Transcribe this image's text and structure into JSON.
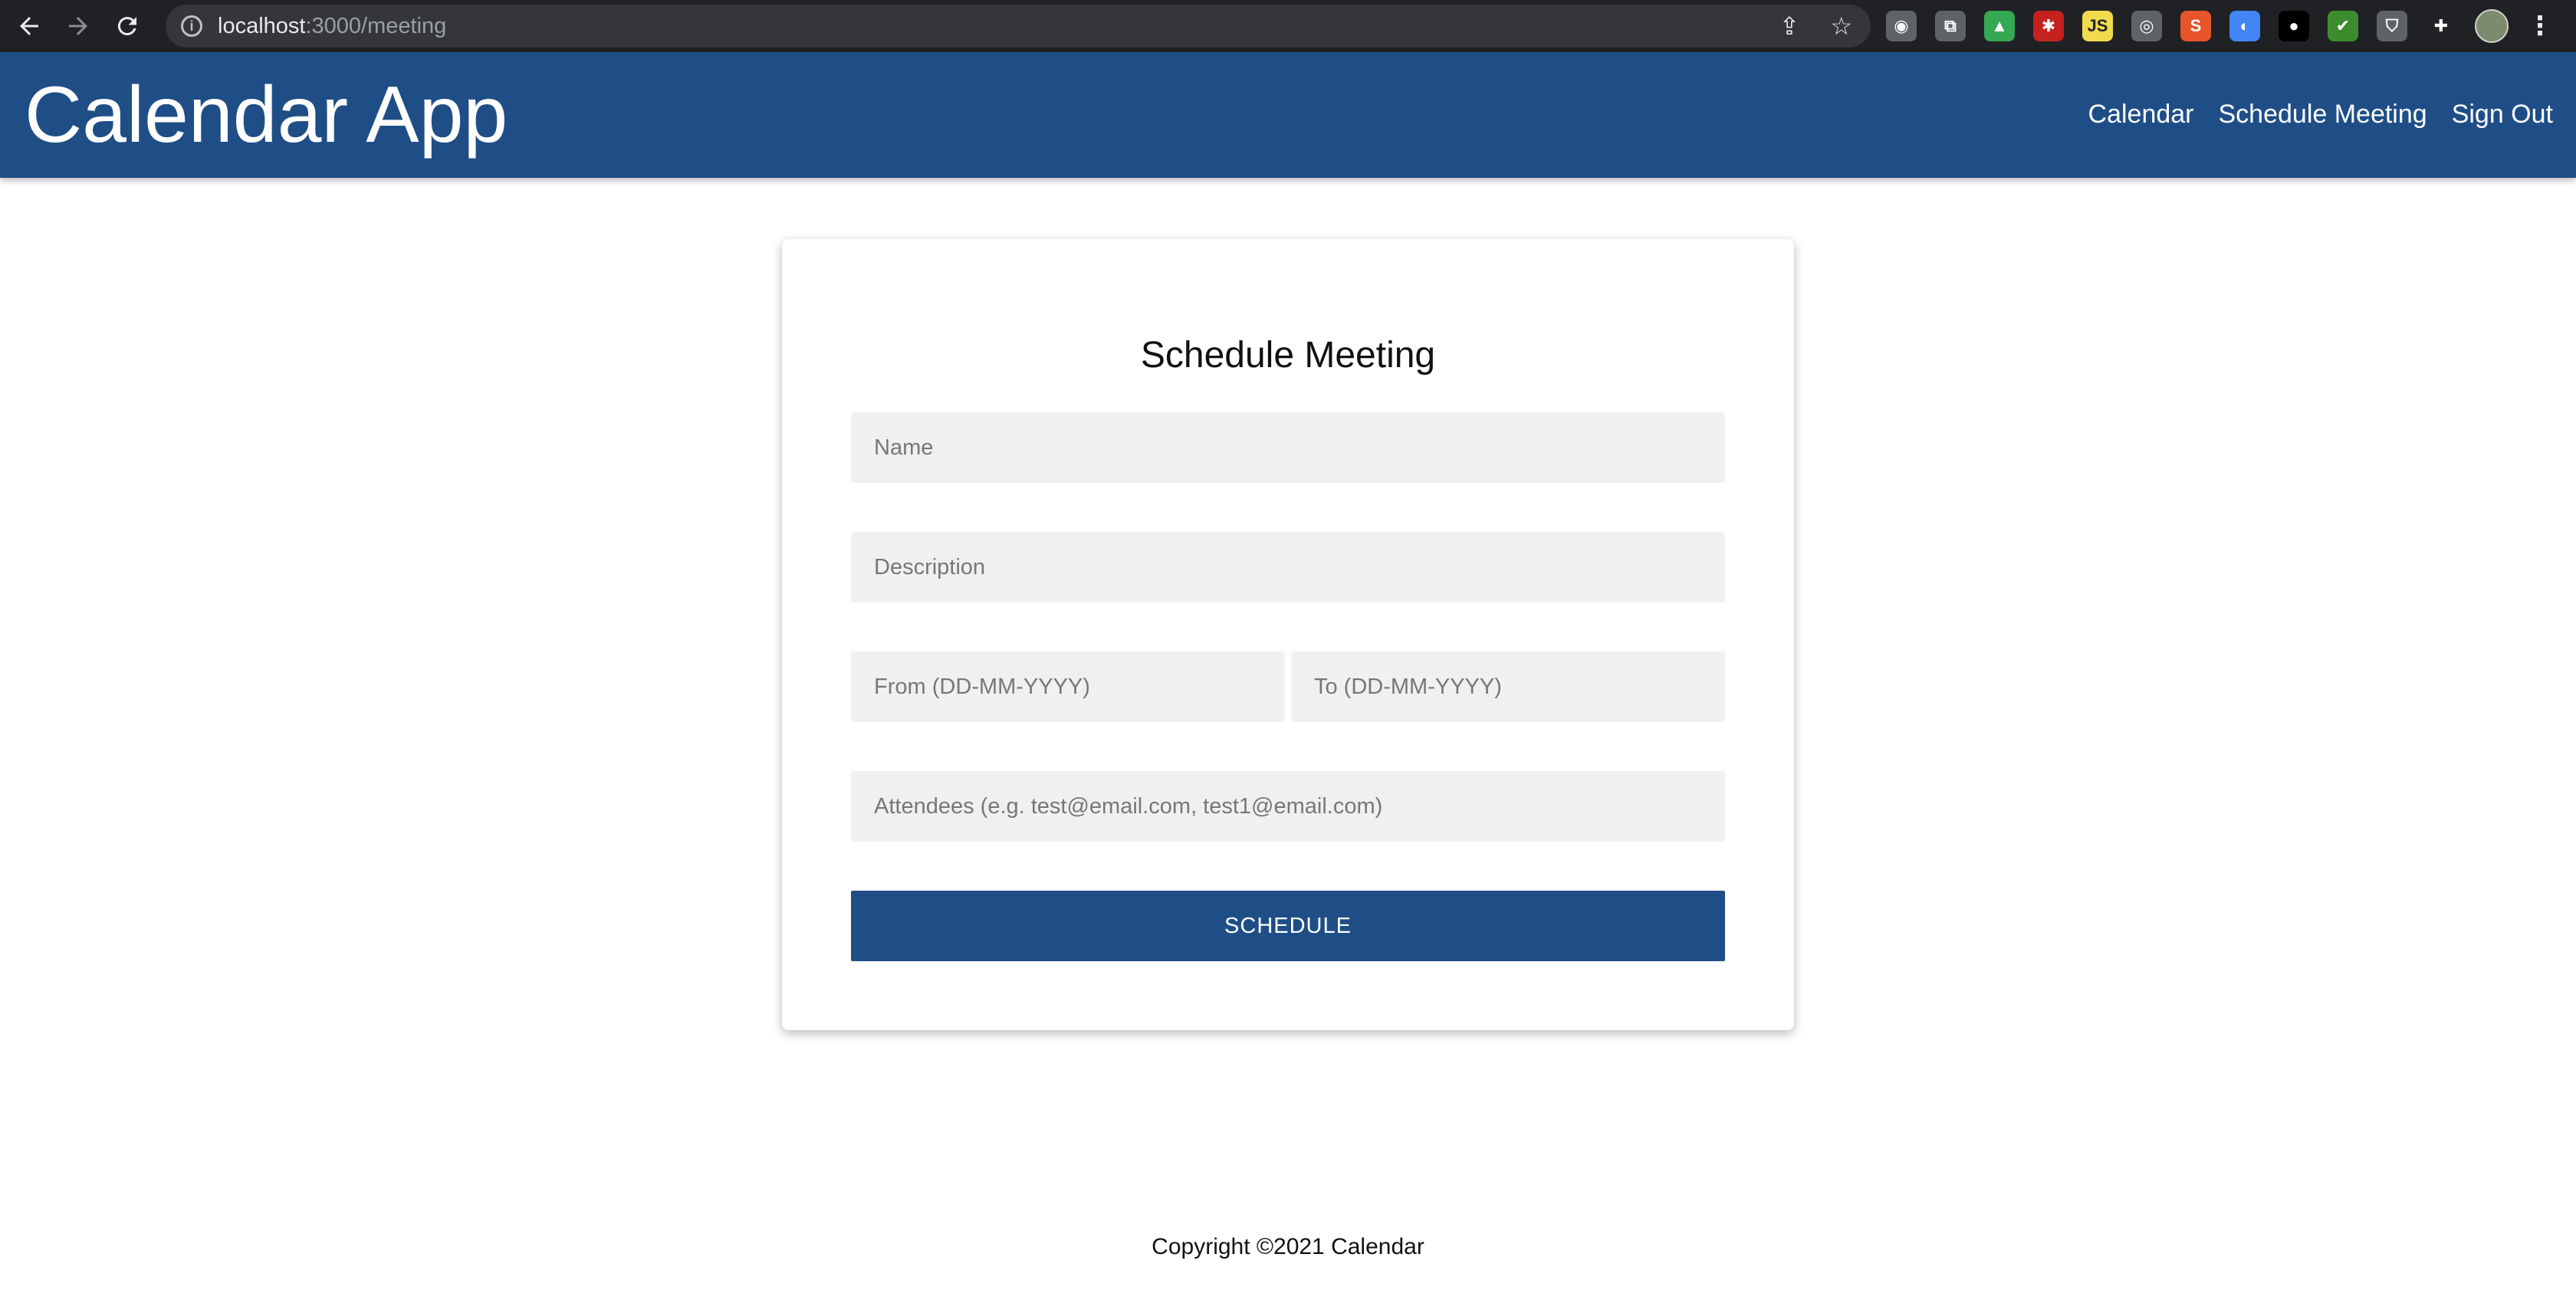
{
  "browser": {
    "url_host": "localhost",
    "url_path": ":3000/meeting",
    "back_icon": "arrow-left-icon",
    "forward_icon": "arrow-right-icon",
    "reload_icon": "reload-icon",
    "extensions": [
      {
        "name": "camera-icon",
        "color": "#5f6368",
        "glyph": "◉"
      },
      {
        "name": "translate-icon",
        "color": "#5f6368",
        "glyph": "⧉"
      },
      {
        "name": "drive-icon",
        "color": "#34a853",
        "glyph": "▲"
      },
      {
        "name": "puzzle-red-icon",
        "color": "#c5221f",
        "glyph": "✱"
      },
      {
        "name": "js-icon",
        "color": "#f0db4f",
        "glyph": "JS"
      },
      {
        "name": "target-icon",
        "color": "#5f6368",
        "glyph": "◎"
      },
      {
        "name": "s-icon",
        "color": "#e8552b",
        "glyph": "S"
      },
      {
        "name": "google-lens-icon",
        "color": "#4285f4",
        "glyph": "◐"
      },
      {
        "name": "circle-icon",
        "color": "#000000",
        "glyph": "●"
      },
      {
        "name": "check-icon",
        "color": "#3c8c2e",
        "glyph": "✔"
      },
      {
        "name": "shield-icon",
        "color": "#5f6368",
        "glyph": "⛉"
      },
      {
        "name": "extensions-icon",
        "color": "#202124",
        "glyph": "✚"
      }
    ]
  },
  "header": {
    "title": "Calendar App",
    "nav": [
      "Calendar",
      "Schedule Meeting",
      "Sign Out"
    ],
    "color": "#1f4e87"
  },
  "form": {
    "title": "Schedule Meeting",
    "name_placeholder": "Name",
    "description_placeholder": "Description",
    "from_placeholder": "From (DD-MM-YYYY)",
    "to_placeholder": "To (DD-MM-YYYY)",
    "attendees_placeholder": "Attendees (e.g. test@email.com, test1@email.com)",
    "submit_label": "SCHEDULE"
  },
  "footer": {
    "text": "Copyright ©2021 Calendar"
  }
}
